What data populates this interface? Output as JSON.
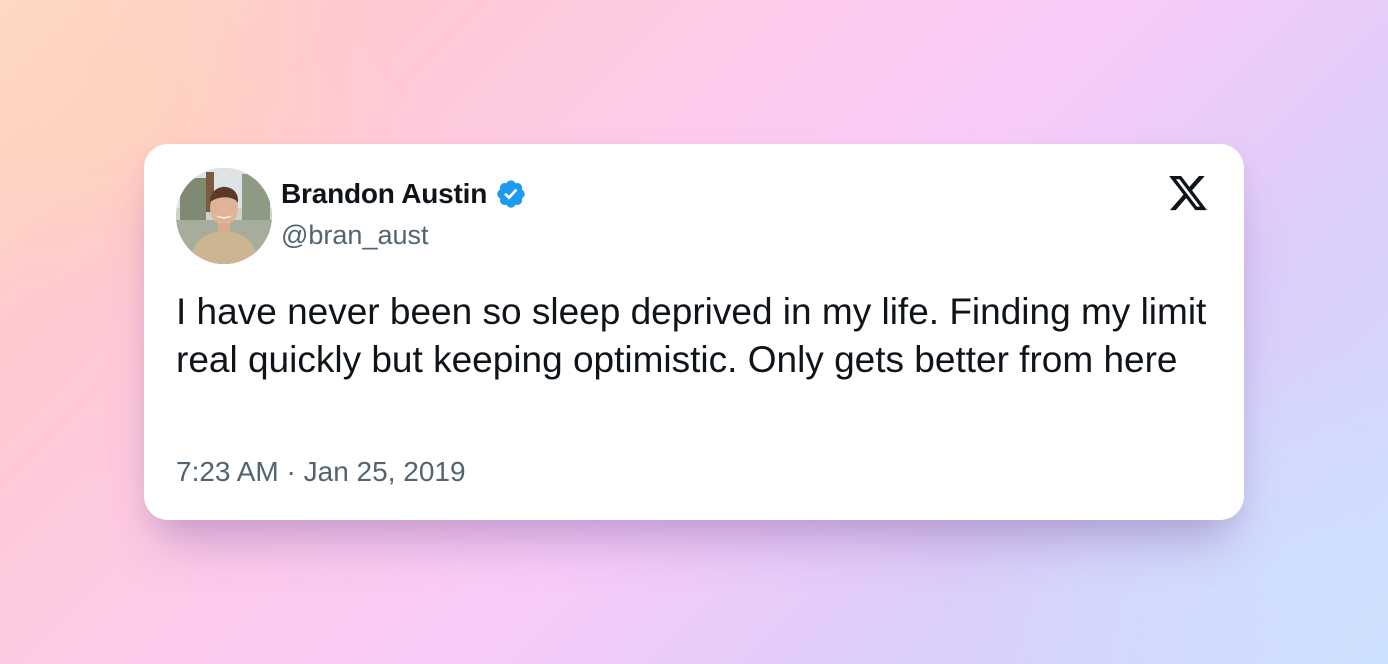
{
  "tweet": {
    "author": {
      "display_name": "Brandon Austin",
      "handle": "@bran_aust",
      "verified": true,
      "avatar": "profile-photo"
    },
    "text": "I have never been so sleep deprived in my life. Finding my limit real quickly but keeping optimistic. Only gets better from here",
    "time": "7:23 AM",
    "separator": "·",
    "date": "Jan 25, 2019",
    "platform_icon": "x-logo-icon"
  },
  "colors": {
    "text_primary": "#0f1419",
    "text_secondary": "#536471",
    "verified_badge": "#1d9bf0",
    "card_background": "#ffffff"
  }
}
